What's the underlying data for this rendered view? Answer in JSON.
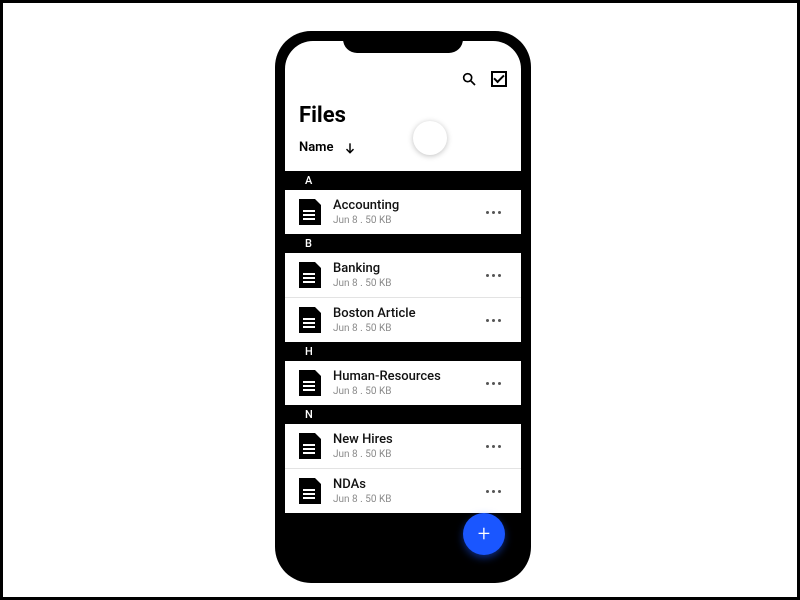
{
  "header": {
    "title": "Files",
    "sort_label": "Name"
  },
  "sections": [
    {
      "letter": "A",
      "items": [
        {
          "name": "Accounting",
          "meta": "Jun 8 . 50 KB"
        }
      ]
    },
    {
      "letter": "B",
      "items": [
        {
          "name": "Banking",
          "meta": "Jun 8 . 50 KB"
        },
        {
          "name": "Boston Article",
          "meta": "Jun 8 . 50 KB"
        }
      ]
    },
    {
      "letter": "H",
      "items": [
        {
          "name": "Human-Resources",
          "meta": "Jun 8 . 50 KB"
        }
      ]
    },
    {
      "letter": "N",
      "items": [
        {
          "name": "New Hires",
          "meta": "Jun 8 . 50 KB"
        },
        {
          "name": "NDAs",
          "meta": "Jun 8 . 50 KB"
        }
      ]
    }
  ],
  "fab_label": "+"
}
